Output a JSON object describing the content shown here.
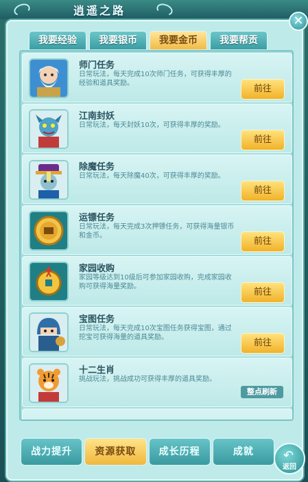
{
  "header": {
    "title": "逍遥之路"
  },
  "tabs": [
    {
      "label": "我要经验",
      "active": false
    },
    {
      "label": "我要银币",
      "active": false
    },
    {
      "label": "我要金币",
      "active": true
    },
    {
      "label": "我要帮贡",
      "active": false
    }
  ],
  "quests": [
    {
      "title": "师门任务",
      "desc": "日常玩法，每天完成10次师门任务，可获得丰厚的经验和道具奖励。",
      "action": "前往",
      "icon": "old-master-portrait-icon"
    },
    {
      "title": "江南封妖",
      "desc": "日常玩法，每天封妖10次，可获得丰厚的奖励。",
      "action": "前往",
      "icon": "demon-portrait-icon"
    },
    {
      "title": "除魔任务",
      "desc": "日常玩法，每天除魔40次，可获得丰厚的奖励。",
      "action": "前往",
      "icon": "zombie-official-portrait-icon"
    },
    {
      "title": "运镖任务",
      "desc": "日常玩法，每天完成3次押镖任务，可获得海量银币和金币。",
      "action": "前往",
      "icon": "escort-coin-icon"
    },
    {
      "title": "家园收购",
      "desc": "家园等级达到10级后可参加家园收购，完成家园收购可获得海量奖励。",
      "action": "前往",
      "icon": "gold-coin-icon"
    },
    {
      "title": "宝图任务",
      "desc": "日常玩法，每天完成10次宝图任务获得宝图，通过挖宝可获得海量的道具奖励。",
      "action": "前往",
      "icon": "ninja-portrait-icon"
    },
    {
      "title": "十二生肖",
      "desc": "挑战玩法，挑战成功可获得丰厚的道具奖励。",
      "badge": "整点刷新",
      "icon": "tiger-portrait-icon"
    }
  ],
  "bottom_nav": [
    {
      "label": "战力提升",
      "active": false
    },
    {
      "label": "资源获取",
      "active": true
    },
    {
      "label": "成长历程",
      "active": false
    },
    {
      "label": "成就",
      "active": false
    }
  ],
  "back": {
    "label": "返回"
  },
  "colors": {
    "panel": "#bfeaea",
    "accent_gold": "#f1b22a",
    "tab_teal": "#3a9ea3"
  }
}
